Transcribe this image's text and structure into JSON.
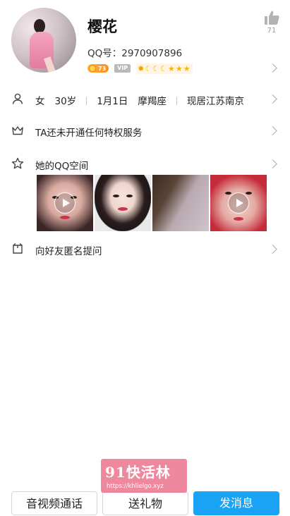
{
  "profile": {
    "nickname": "樱花",
    "qq_label": "QQ号：2970907896",
    "likes": "71",
    "level_badge": "73",
    "vip_badge": "VIP",
    "level_icons": [
      "sun",
      "moon",
      "moon",
      "moon",
      "star",
      "star",
      "star"
    ]
  },
  "info": {
    "gender": "女",
    "age": "30岁",
    "birthday": "1月1日",
    "zodiac": "摩羯座",
    "location": "现居江苏南京"
  },
  "rows": {
    "privilege": "TA还未开通任何特权服务",
    "qzone": "她的QQ空间",
    "anonymous": "向好友匿名提问"
  },
  "photos": [
    {
      "has_video": true
    },
    {
      "has_video": false
    },
    {
      "has_video": false
    },
    {
      "has_video": true
    }
  ],
  "watermark": {
    "title": "91快活林",
    "url": "https://khlielgo.xyz"
  },
  "actions": {
    "call": "音视频通话",
    "gift": "送礼物",
    "message": "发消息"
  },
  "colors": {
    "accent": "#1aa3f5",
    "level_badge": "#ff8c1a",
    "watermark": "#eb7891"
  }
}
